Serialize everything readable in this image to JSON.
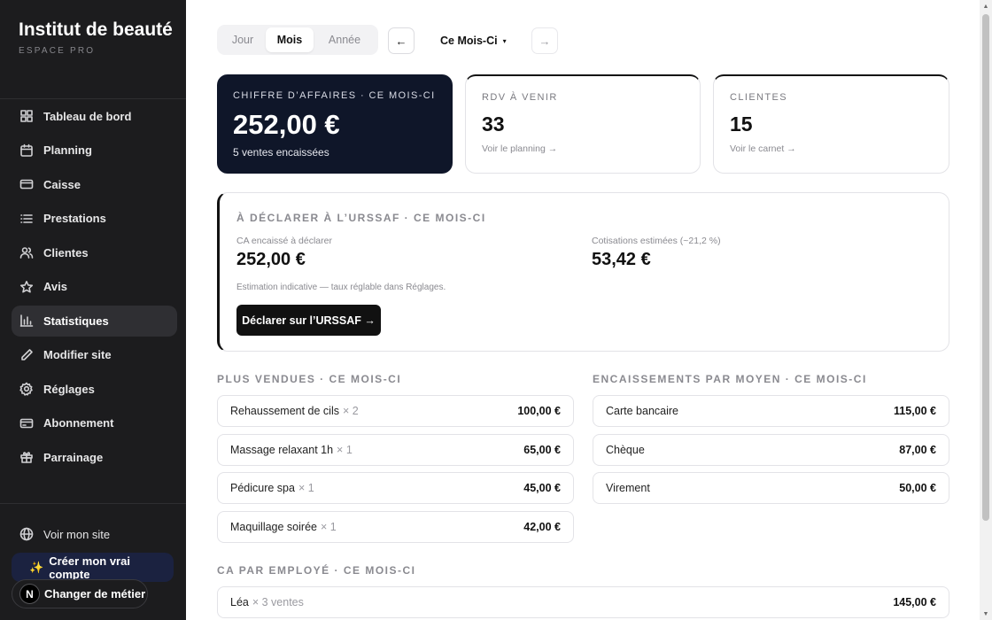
{
  "sidebar": {
    "brand_title": "Institut de beauté",
    "brand_subtitle": "ESPACE PRO",
    "items": [
      {
        "label": "Tableau de bord",
        "icon": "dashboard-icon"
      },
      {
        "label": "Planning",
        "icon": "calendar-icon"
      },
      {
        "label": "Caisse",
        "icon": "cash-register-icon"
      },
      {
        "label": "Prestations",
        "icon": "list-icon"
      },
      {
        "label": "Clientes",
        "icon": "users-icon"
      },
      {
        "label": "Avis",
        "icon": "star-icon"
      },
      {
        "label": "Statistiques",
        "icon": "bar-chart-icon",
        "active": true
      },
      {
        "label": "Modifier site",
        "icon": "pencil-icon"
      },
      {
        "label": "Réglages",
        "icon": "gear-icon"
      },
      {
        "label": "Abonnement",
        "icon": "credit-card-icon"
      },
      {
        "label": "Parrainage",
        "icon": "gift-icon"
      }
    ],
    "view_site": "Voir mon site",
    "create_account": "Créer mon vrai compte",
    "switch_job": "Changer de métier",
    "badge_letter": "N"
  },
  "toolbar": {
    "tabs": [
      "Jour",
      "Mois",
      "Année"
    ],
    "active_tab": "Mois",
    "prev": "←",
    "next": "→",
    "period": "Ce Mois-Ci",
    "caret": "▾"
  },
  "kpis": {
    "revenue": {
      "label": "Chiffre d’affaires · Ce Mois-Ci",
      "value": "252,00 €",
      "sub": "5 ventes encaissées"
    },
    "appointments": {
      "label": "RDV à venir",
      "value": "33",
      "link": "Voir le planning →"
    },
    "clients": {
      "label": "Clientes",
      "value": "15",
      "link": "Voir le carnet →"
    }
  },
  "urssaf": {
    "title": "À déclarer à l’URSSAF · Ce Mois-Ci",
    "ca_label": "CA encaissé à déclarer",
    "ca_value": "252,00 €",
    "cotis_label": "Cotisations estimées (~21,2 %)",
    "cotis_value": "53,42 €",
    "note": "Estimation indicative — taux réglable dans Réglages.",
    "button": "Déclarer sur l’URSSAF →"
  },
  "top_sellers": {
    "title": "Plus vendues · Ce Mois-Ci",
    "items": [
      {
        "name": "Rehaussement de cils",
        "qty": "× 2",
        "amount": "100,00 €"
      },
      {
        "name": "Massage relaxant 1h",
        "qty": "× 1",
        "amount": "65,00 €"
      },
      {
        "name": "Pédicure spa",
        "qty": "× 1",
        "amount": "45,00 €"
      },
      {
        "name": "Maquillage soirée",
        "qty": "× 1",
        "amount": "42,00 €"
      }
    ]
  },
  "payments": {
    "title": "Encaissements par moyen · Ce Mois-Ci",
    "items": [
      {
        "name": "Carte bancaire",
        "amount": "115,00 €"
      },
      {
        "name": "Chèque",
        "amount": "87,00 €"
      },
      {
        "name": "Virement",
        "amount": "50,00 €"
      }
    ]
  },
  "employees": {
    "title": "CA par employé · Ce Mois-Ci",
    "items": [
      {
        "name": "Léa",
        "sales": "× 3 ventes",
        "amount": "145,00 €"
      }
    ]
  },
  "colors": {
    "sidebar": "#1c1c1e",
    "dark_card": "#0f1629",
    "create_button": "#1b2240",
    "accent_spark": "#f5c242"
  }
}
